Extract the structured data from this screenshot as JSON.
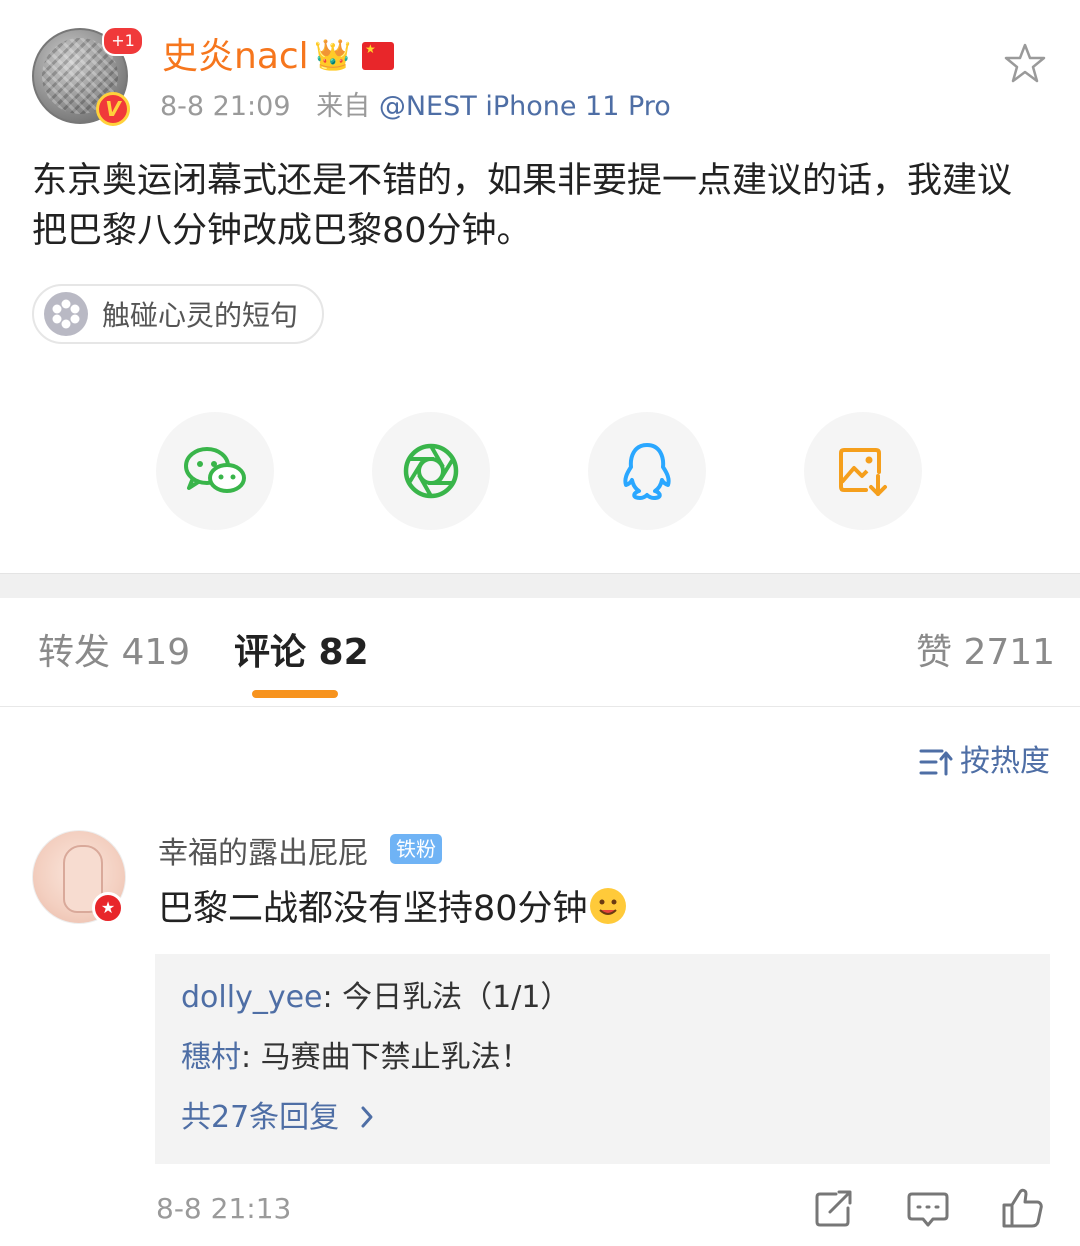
{
  "post": {
    "username": "史炎nacl",
    "avatar_badge": "+1",
    "avatar_v": "V",
    "time": "8-8 21:09",
    "source_prefix": "来自",
    "source": "@NEST iPhone 11 Pro",
    "text": "东京奥运闭幕式还是不错的，如果非要提一点建议的话，我建议把巴黎八分钟改成巴黎80分钟。",
    "topic": "触碰心灵的短句"
  },
  "share": {
    "items": [
      "wechat-icon",
      "moments-icon",
      "qq-icon",
      "save-image-icon"
    ],
    "colors": {
      "wechat": "#39b54a",
      "moments": "#39b54a",
      "qq": "#2aa7ff",
      "save": "#f59f1c"
    }
  },
  "tabs": {
    "repost": "转发 419",
    "comments": "评论 82",
    "likes": "赞 2711",
    "active_color": "#f7931e"
  },
  "sort": {
    "label": "按热度"
  },
  "comment": {
    "username": "幸福的露出屁屁",
    "fan_badge": "铁粉",
    "text": "巴黎二战都没有坚持80分钟",
    "replies": [
      {
        "user": "dolly_yee",
        "text": ": 今日乳法（1/1）"
      },
      {
        "user": "穗村",
        "text": ": 马赛曲下禁止乳法！"
      }
    ],
    "more": "共27条回复",
    "time": "8-8 21:13"
  }
}
